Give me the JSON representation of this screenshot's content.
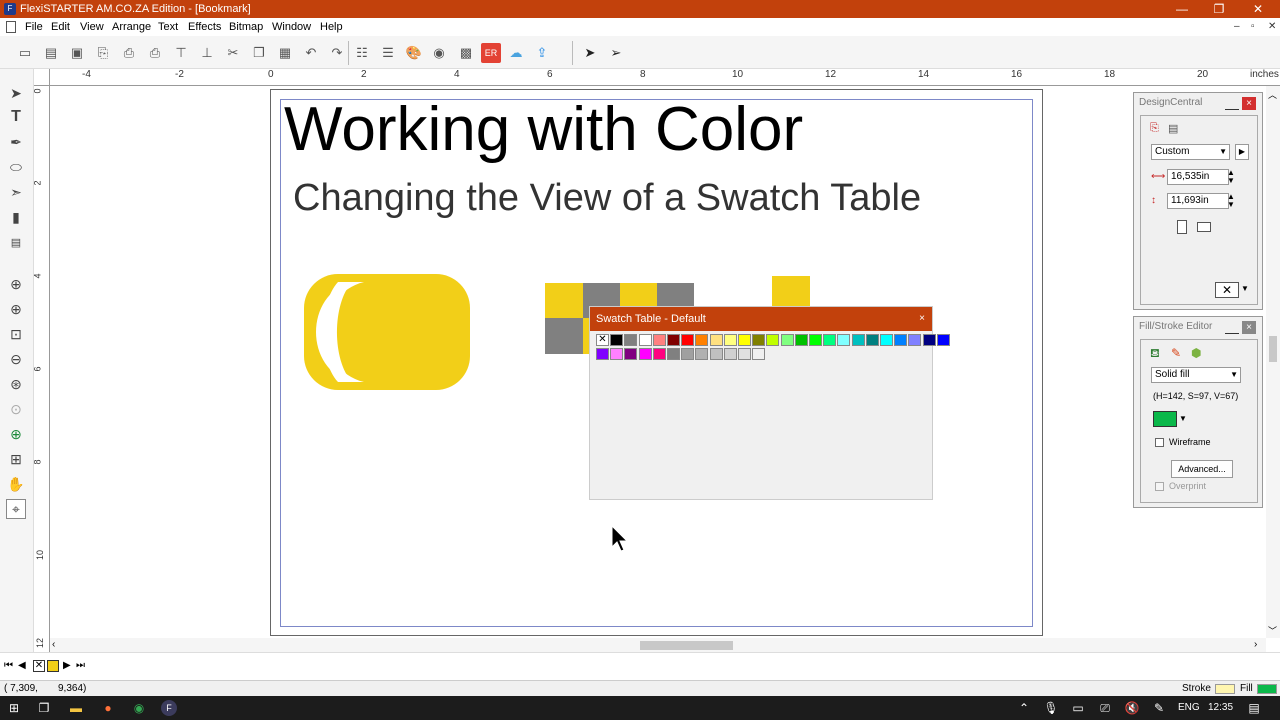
{
  "window": {
    "title": "FlexiSTARTER AM.CO.ZA Edition - [Bookmark]",
    "icon_label": "F",
    "controls": [
      "—",
      "❐",
      "✕"
    ],
    "mdi_controls": [
      "–",
      "▫",
      "✕"
    ]
  },
  "menu": [
    "File",
    "Edit",
    "View",
    "Arrange",
    "Text",
    "Effects",
    "Bitmap",
    "Window",
    "Help"
  ],
  "ruler": {
    "h_labels": [
      "-4",
      "-2",
      "0",
      "2",
      "4",
      "6",
      "8",
      "10",
      "12",
      "14",
      "16",
      "18",
      "20"
    ],
    "unit": "inches",
    "v_labels": [
      "0",
      "2",
      "4",
      "6",
      "8",
      "10",
      "12"
    ]
  },
  "document": {
    "heading": "Working with Color",
    "subheading": "Changing the View of a Swatch Table"
  },
  "swatch_table": {
    "title": "Swatch Table - Default",
    "close": "×",
    "row1": [
      "none",
      "#000000",
      "#808080",
      "#ffffff",
      "#ff8080",
      "#800000",
      "#ff0000",
      "#ff8000",
      "#ffe080",
      "#ffff80",
      "#ffff00",
      "#808000",
      "#c0ff00",
      "#80ff80",
      "#00c000",
      "#00ff00",
      "#00ff80",
      "#80ffff",
      "#00c0c0",
      "#008080",
      "#00ffff",
      "#0080ff",
      "#8080ff",
      "#000080",
      "#0000ff"
    ],
    "row2": [
      "#8000ff",
      "#ff80ff",
      "#800080",
      "#ff00ff",
      "#ff0080",
      "#808080",
      "#a0a0a0",
      "#b0b0b0",
      "#c0c0c0",
      "#d0d0d0",
      "#e0e0e0",
      "#f0f0f0"
    ]
  },
  "design_central": {
    "title": "DesignCentral",
    "preset": "Custom",
    "width": "16,535in",
    "height": "11,693in"
  },
  "fill_stroke": {
    "title": "Fill/Stroke Editor",
    "fill_type": "Solid fill",
    "hsv": "(H=142, S=97, V=67)",
    "fill_color": "#0bb84a",
    "wireframe": "Wireframe",
    "advanced": "Advanced...",
    "overprint": "Overprint"
  },
  "status": {
    "coords_x": "( 7,309,",
    "coords_y": "9,364)",
    "stroke_label": "Stroke",
    "fill_label": "Fill",
    "stroke_color": "#fff6b0",
    "fill_color": "#0bb84a"
  },
  "taskbar": {
    "lang": "ENG",
    "time": "12:35"
  },
  "colors": {
    "accent": "#c2410c",
    "yellow": "#f2cf18",
    "gray": "#808080"
  }
}
